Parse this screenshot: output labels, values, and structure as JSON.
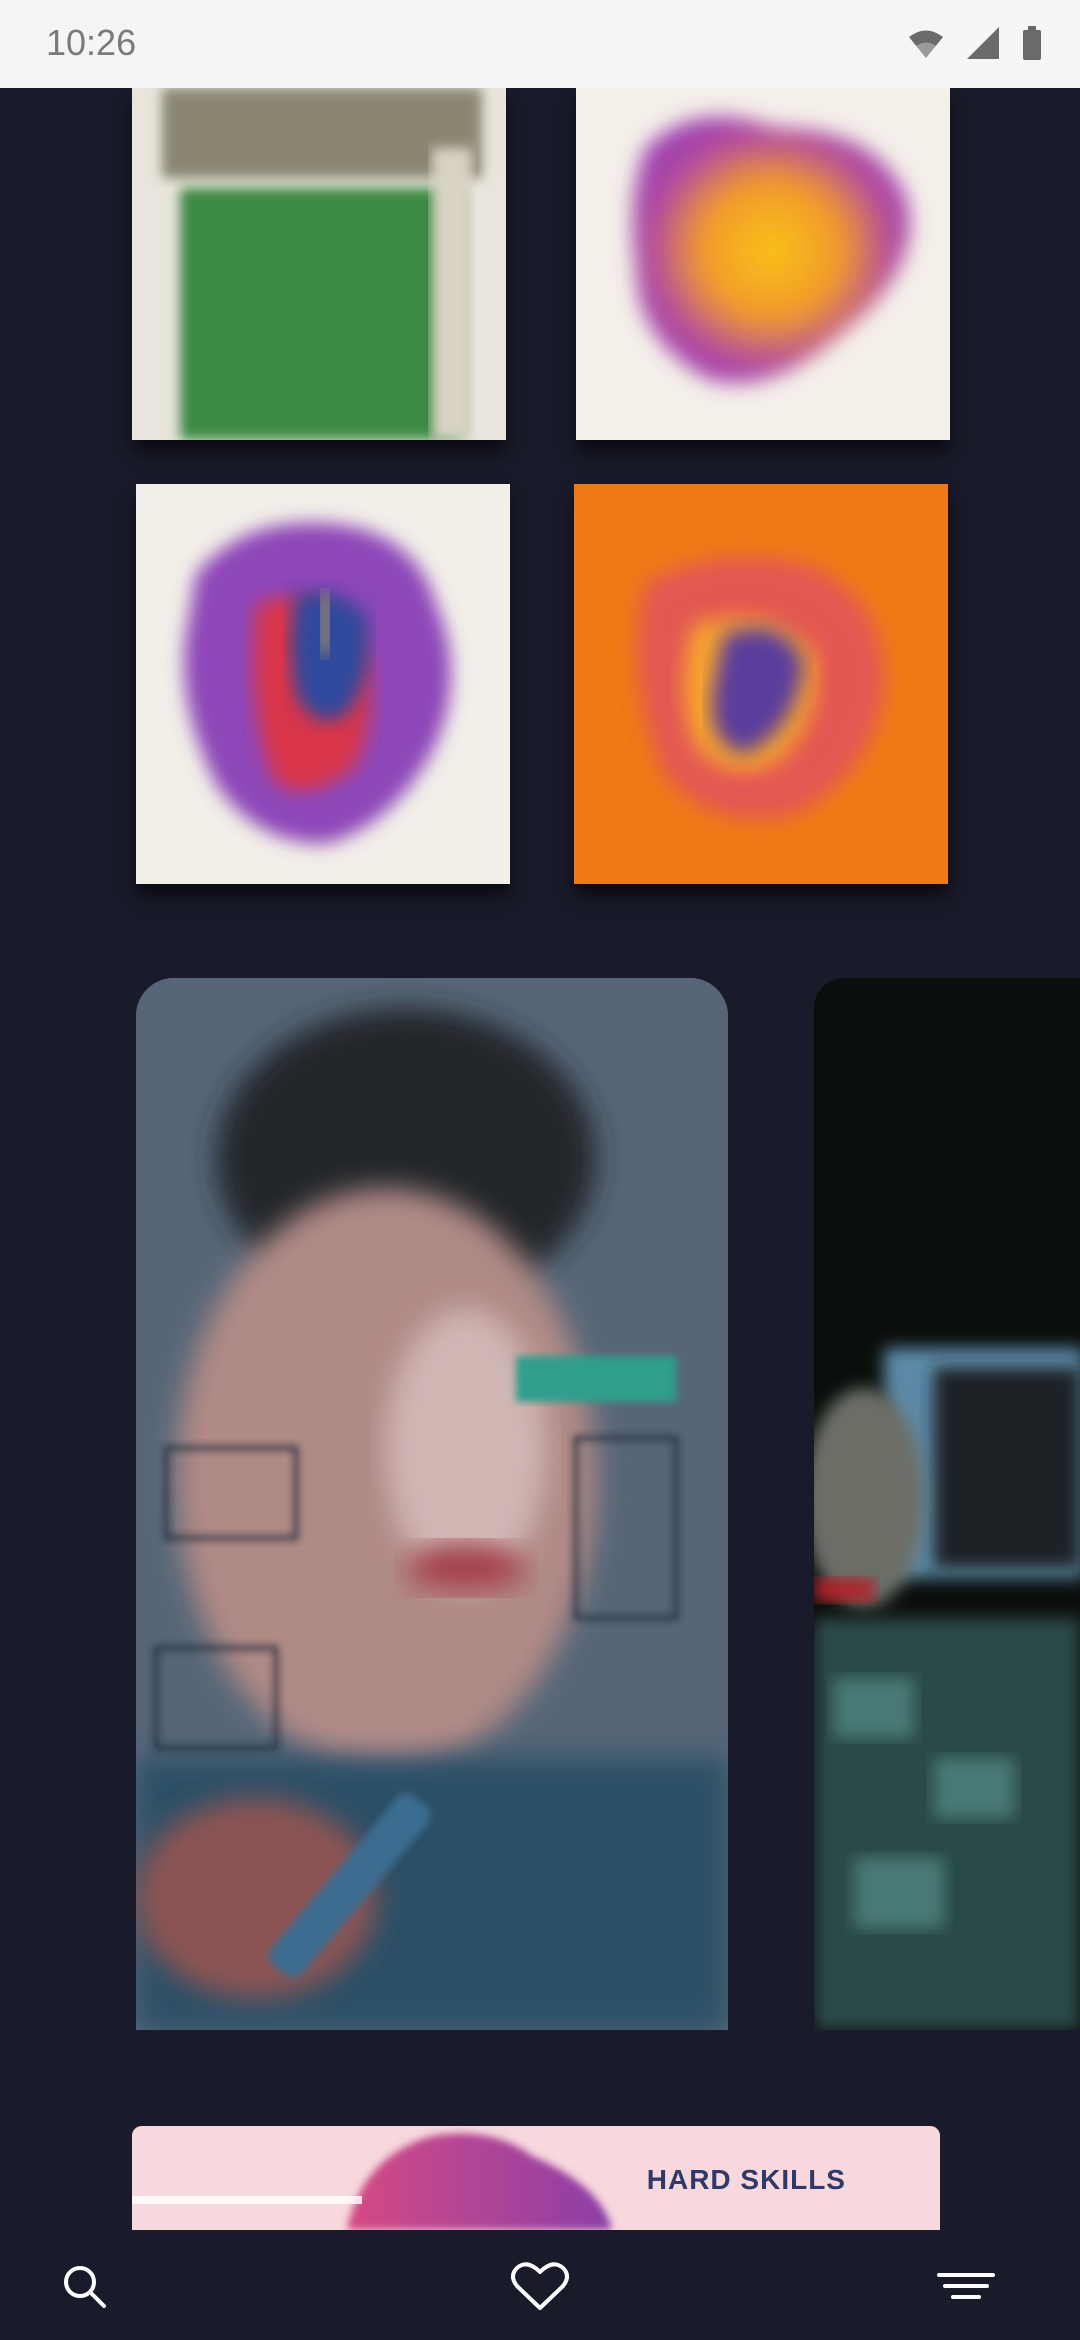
{
  "status_bar": {
    "time": "10:26",
    "icons": [
      "wifi-icon",
      "cell-signal-icon",
      "battery-icon"
    ]
  },
  "gallery": {
    "banner": {
      "title": "HARD SKILLS"
    }
  },
  "bottom_nav": {
    "items": [
      "search-icon",
      "heart-icon",
      "menu-icon"
    ]
  },
  "colors": {
    "background": "#1a1b2a",
    "status_bar": "#f5f5f5",
    "accent_orange": "#ef7a16",
    "banner_bg": "#f7d8dc",
    "banner_text": "#2e3a6a"
  }
}
